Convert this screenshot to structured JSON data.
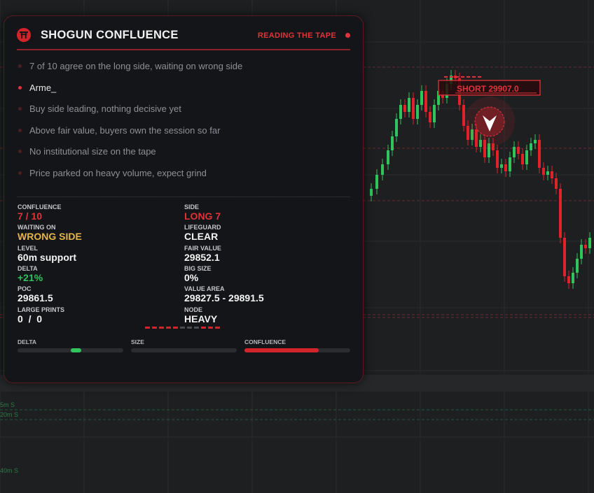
{
  "panel": {
    "title": "SHOGUN CONFLUENCE",
    "state": "READING THE TAPE",
    "notes": [
      {
        "text": "7 of 10 agree on the long side, waiting on wrong side",
        "active": false
      },
      {
        "text": "Arme_",
        "active": true
      },
      {
        "text": "Buy side leading, nothing decisive yet",
        "active": false
      },
      {
        "text": "Above fair value, buyers own the session so far",
        "active": false
      },
      {
        "text": "No institutional size on the tape",
        "active": false
      },
      {
        "text": "Price parked on heavy volume, expect grind",
        "active": false
      }
    ],
    "stats": {
      "confluence": {
        "label": "CONFLUENCE",
        "value": "7 / 10"
      },
      "side": {
        "label": "SIDE",
        "value": "LONG 7"
      },
      "waiting_on": {
        "label": "WAITING ON",
        "value": "WRONG SIDE"
      },
      "lifeguard": {
        "label": "LIFEGUARD",
        "value": "CLEAR"
      },
      "level": {
        "label": "LEVEL",
        "value": "60m support"
      },
      "fair_value": {
        "label": "FAIR VALUE",
        "value": "29852.1"
      },
      "delta": {
        "label": "DELTA",
        "value": "+21%"
      },
      "big_size": {
        "label": "BIG SIZE",
        "value": "0%"
      },
      "poc": {
        "label": "POC",
        "value": "29861.5"
      },
      "value_area": {
        "label": "VALUE AREA",
        "value": "29827.5 - 29891.5"
      },
      "large_prints": {
        "label": "LARGE PRINTS",
        "value": "0  /  0"
      },
      "node": {
        "label": "NODE",
        "value": "HEAVY"
      }
    },
    "meters": {
      "delta": {
        "label": "DELTA",
        "value": 0.1
      },
      "size": {
        "label": "SIZE",
        "value": 0
      },
      "confluence": {
        "label": "CONFLUENCE",
        "value": 0.7
      }
    }
  },
  "chart": {
    "signal_label": "SHORT  29907.0",
    "level_labels": [
      "5m S",
      "20m S",
      "40m S"
    ],
    "colors": {
      "bull": "#2fc45c",
      "bear": "#e0222a",
      "accent": "#e0333a",
      "bg": "#1e1f21"
    }
  }
}
